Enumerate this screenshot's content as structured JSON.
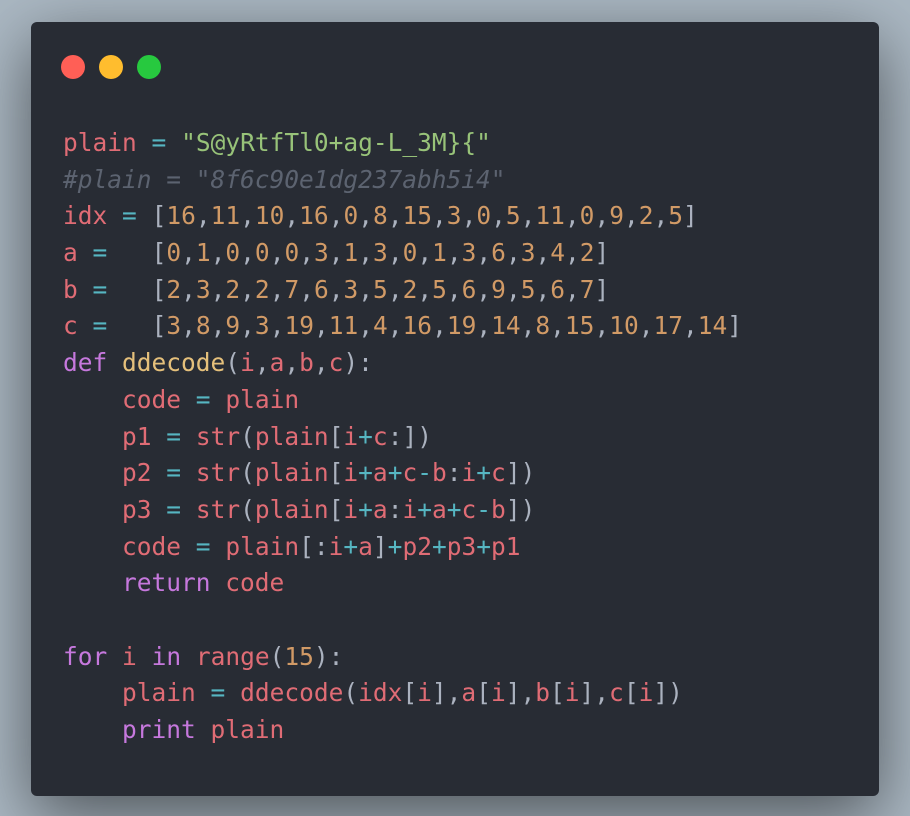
{
  "window": {
    "colors": {
      "background": "#282c34",
      "page": "#abb8c3",
      "red": "#ff5f56",
      "yellow": "#ffbd2e",
      "green": "#27c93f"
    },
    "controls": [
      "close-dot",
      "minimize-dot",
      "maximize-dot"
    ]
  },
  "code_lines": [
    [
      [
        "var",
        "plain"
      ],
      [
        "plain",
        " "
      ],
      [
        "op",
        "="
      ],
      [
        "plain",
        " "
      ],
      [
        "str",
        "\"S@yRtfTl0+ag-L_3M}{\""
      ]
    ],
    [
      [
        "comment",
        "#plain = \"8f6c90e1dg237abh5i4\""
      ]
    ],
    [
      [
        "var",
        "idx"
      ],
      [
        "plain",
        " "
      ],
      [
        "op",
        "="
      ],
      [
        "plain",
        " "
      ],
      [
        "punc",
        "["
      ],
      [
        "num",
        "16"
      ],
      [
        "punc",
        ","
      ],
      [
        "num",
        "11"
      ],
      [
        "punc",
        ","
      ],
      [
        "num",
        "10"
      ],
      [
        "punc",
        ","
      ],
      [
        "num",
        "16"
      ],
      [
        "punc",
        ","
      ],
      [
        "num",
        "0"
      ],
      [
        "punc",
        ","
      ],
      [
        "num",
        "8"
      ],
      [
        "punc",
        ","
      ],
      [
        "num",
        "15"
      ],
      [
        "punc",
        ","
      ],
      [
        "num",
        "3"
      ],
      [
        "punc",
        ","
      ],
      [
        "num",
        "0"
      ],
      [
        "punc",
        ","
      ],
      [
        "num",
        "5"
      ],
      [
        "punc",
        ","
      ],
      [
        "num",
        "11"
      ],
      [
        "punc",
        ","
      ],
      [
        "num",
        "0"
      ],
      [
        "punc",
        ","
      ],
      [
        "num",
        "9"
      ],
      [
        "punc",
        ","
      ],
      [
        "num",
        "2"
      ],
      [
        "punc",
        ","
      ],
      [
        "num",
        "5"
      ],
      [
        "punc",
        "]"
      ]
    ],
    [
      [
        "var",
        "a"
      ],
      [
        "plain",
        " "
      ],
      [
        "op",
        "="
      ],
      [
        "plain",
        "   "
      ],
      [
        "punc",
        "["
      ],
      [
        "num",
        "0"
      ],
      [
        "punc",
        ","
      ],
      [
        "num",
        "1"
      ],
      [
        "punc",
        ","
      ],
      [
        "num",
        "0"
      ],
      [
        "punc",
        ","
      ],
      [
        "num",
        "0"
      ],
      [
        "punc",
        ","
      ],
      [
        "num",
        "0"
      ],
      [
        "punc",
        ","
      ],
      [
        "num",
        "3"
      ],
      [
        "punc",
        ","
      ],
      [
        "num",
        "1"
      ],
      [
        "punc",
        ","
      ],
      [
        "num",
        "3"
      ],
      [
        "punc",
        ","
      ],
      [
        "num",
        "0"
      ],
      [
        "punc",
        ","
      ],
      [
        "num",
        "1"
      ],
      [
        "punc",
        ","
      ],
      [
        "num",
        "3"
      ],
      [
        "punc",
        ","
      ],
      [
        "num",
        "6"
      ],
      [
        "punc",
        ","
      ],
      [
        "num",
        "3"
      ],
      [
        "punc",
        ","
      ],
      [
        "num",
        "4"
      ],
      [
        "punc",
        ","
      ],
      [
        "num",
        "2"
      ],
      [
        "punc",
        "]"
      ]
    ],
    [
      [
        "var",
        "b"
      ],
      [
        "plain",
        " "
      ],
      [
        "op",
        "="
      ],
      [
        "plain",
        "   "
      ],
      [
        "punc",
        "["
      ],
      [
        "num",
        "2"
      ],
      [
        "punc",
        ","
      ],
      [
        "num",
        "3"
      ],
      [
        "punc",
        ","
      ],
      [
        "num",
        "2"
      ],
      [
        "punc",
        ","
      ],
      [
        "num",
        "2"
      ],
      [
        "punc",
        ","
      ],
      [
        "num",
        "7"
      ],
      [
        "punc",
        ","
      ],
      [
        "num",
        "6"
      ],
      [
        "punc",
        ","
      ],
      [
        "num",
        "3"
      ],
      [
        "punc",
        ","
      ],
      [
        "num",
        "5"
      ],
      [
        "punc",
        ","
      ],
      [
        "num",
        "2"
      ],
      [
        "punc",
        ","
      ],
      [
        "num",
        "5"
      ],
      [
        "punc",
        ","
      ],
      [
        "num",
        "6"
      ],
      [
        "punc",
        ","
      ],
      [
        "num",
        "9"
      ],
      [
        "punc",
        ","
      ],
      [
        "num",
        "5"
      ],
      [
        "punc",
        ","
      ],
      [
        "num",
        "6"
      ],
      [
        "punc",
        ","
      ],
      [
        "num",
        "7"
      ],
      [
        "punc",
        "]"
      ]
    ],
    [
      [
        "var",
        "c"
      ],
      [
        "plain",
        " "
      ],
      [
        "op",
        "="
      ],
      [
        "plain",
        "   "
      ],
      [
        "punc",
        "["
      ],
      [
        "num",
        "3"
      ],
      [
        "punc",
        ","
      ],
      [
        "num",
        "8"
      ],
      [
        "punc",
        ","
      ],
      [
        "num",
        "9"
      ],
      [
        "punc",
        ","
      ],
      [
        "num",
        "3"
      ],
      [
        "punc",
        ","
      ],
      [
        "num",
        "19"
      ],
      [
        "punc",
        ","
      ],
      [
        "num",
        "11"
      ],
      [
        "punc",
        ","
      ],
      [
        "num",
        "4"
      ],
      [
        "punc",
        ","
      ],
      [
        "num",
        "16"
      ],
      [
        "punc",
        ","
      ],
      [
        "num",
        "19"
      ],
      [
        "punc",
        ","
      ],
      [
        "num",
        "14"
      ],
      [
        "punc",
        ","
      ],
      [
        "num",
        "8"
      ],
      [
        "punc",
        ","
      ],
      [
        "num",
        "15"
      ],
      [
        "punc",
        ","
      ],
      [
        "num",
        "10"
      ],
      [
        "punc",
        ","
      ],
      [
        "num",
        "17"
      ],
      [
        "punc",
        ","
      ],
      [
        "num",
        "14"
      ],
      [
        "punc",
        "]"
      ]
    ],
    [
      [
        "kw",
        "def"
      ],
      [
        "plain",
        " "
      ],
      [
        "fn",
        "ddecode"
      ],
      [
        "punc",
        "("
      ],
      [
        "var",
        "i"
      ],
      [
        "punc",
        ","
      ],
      [
        "var",
        "a"
      ],
      [
        "punc",
        ","
      ],
      [
        "var",
        "b"
      ],
      [
        "punc",
        ","
      ],
      [
        "var",
        "c"
      ],
      [
        "punc",
        "):"
      ]
    ],
    [
      [
        "plain",
        "    "
      ],
      [
        "var",
        "code"
      ],
      [
        "plain",
        " "
      ],
      [
        "op",
        "="
      ],
      [
        "plain",
        " "
      ],
      [
        "var",
        "plain"
      ]
    ],
    [
      [
        "plain",
        "    "
      ],
      [
        "var",
        "p1"
      ],
      [
        "plain",
        " "
      ],
      [
        "op",
        "="
      ],
      [
        "plain",
        " "
      ],
      [
        "call",
        "str"
      ],
      [
        "punc",
        "("
      ],
      [
        "var",
        "plain"
      ],
      [
        "punc",
        "["
      ],
      [
        "var",
        "i"
      ],
      [
        "op",
        "+"
      ],
      [
        "var",
        "c"
      ],
      [
        "punc",
        ":])"
      ]
    ],
    [
      [
        "plain",
        "    "
      ],
      [
        "var",
        "p2"
      ],
      [
        "plain",
        " "
      ],
      [
        "op",
        "="
      ],
      [
        "plain",
        " "
      ],
      [
        "call",
        "str"
      ],
      [
        "punc",
        "("
      ],
      [
        "var",
        "plain"
      ],
      [
        "punc",
        "["
      ],
      [
        "var",
        "i"
      ],
      [
        "op",
        "+"
      ],
      [
        "var",
        "a"
      ],
      [
        "op",
        "+"
      ],
      [
        "var",
        "c"
      ],
      [
        "op",
        "-"
      ],
      [
        "var",
        "b"
      ],
      [
        "punc",
        ":"
      ],
      [
        "var",
        "i"
      ],
      [
        "op",
        "+"
      ],
      [
        "var",
        "c"
      ],
      [
        "punc",
        "])"
      ]
    ],
    [
      [
        "plain",
        "    "
      ],
      [
        "var",
        "p3"
      ],
      [
        "plain",
        " "
      ],
      [
        "op",
        "="
      ],
      [
        "plain",
        " "
      ],
      [
        "call",
        "str"
      ],
      [
        "punc",
        "("
      ],
      [
        "var",
        "plain"
      ],
      [
        "punc",
        "["
      ],
      [
        "var",
        "i"
      ],
      [
        "op",
        "+"
      ],
      [
        "var",
        "a"
      ],
      [
        "punc",
        ":"
      ],
      [
        "var",
        "i"
      ],
      [
        "op",
        "+"
      ],
      [
        "var",
        "a"
      ],
      [
        "op",
        "+"
      ],
      [
        "var",
        "c"
      ],
      [
        "op",
        "-"
      ],
      [
        "var",
        "b"
      ],
      [
        "punc",
        "])"
      ]
    ],
    [
      [
        "plain",
        "    "
      ],
      [
        "var",
        "code"
      ],
      [
        "plain",
        " "
      ],
      [
        "op",
        "="
      ],
      [
        "plain",
        " "
      ],
      [
        "var",
        "plain"
      ],
      [
        "punc",
        "[:"
      ],
      [
        "var",
        "i"
      ],
      [
        "op",
        "+"
      ],
      [
        "var",
        "a"
      ],
      [
        "punc",
        "]"
      ],
      [
        "op",
        "+"
      ],
      [
        "var",
        "p2"
      ],
      [
        "op",
        "+"
      ],
      [
        "var",
        "p3"
      ],
      [
        "op",
        "+"
      ],
      [
        "var",
        "p1"
      ]
    ],
    [
      [
        "plain",
        "    "
      ],
      [
        "kw",
        "return"
      ],
      [
        "plain",
        " "
      ],
      [
        "var",
        "code"
      ]
    ],
    [],
    [
      [
        "kw",
        "for"
      ],
      [
        "plain",
        " "
      ],
      [
        "var",
        "i"
      ],
      [
        "plain",
        " "
      ],
      [
        "kw",
        "in"
      ],
      [
        "plain",
        " "
      ],
      [
        "call",
        "range"
      ],
      [
        "punc",
        "("
      ],
      [
        "num",
        "15"
      ],
      [
        "punc",
        "):"
      ]
    ],
    [
      [
        "plain",
        "    "
      ],
      [
        "var",
        "plain"
      ],
      [
        "plain",
        " "
      ],
      [
        "op",
        "="
      ],
      [
        "plain",
        " "
      ],
      [
        "call",
        "ddecode"
      ],
      [
        "punc",
        "("
      ],
      [
        "var",
        "idx"
      ],
      [
        "punc",
        "["
      ],
      [
        "var",
        "i"
      ],
      [
        "punc",
        "],"
      ],
      [
        "var",
        "a"
      ],
      [
        "punc",
        "["
      ],
      [
        "var",
        "i"
      ],
      [
        "punc",
        "],"
      ],
      [
        "var",
        "b"
      ],
      [
        "punc",
        "["
      ],
      [
        "var",
        "i"
      ],
      [
        "punc",
        "],"
      ],
      [
        "var",
        "c"
      ],
      [
        "punc",
        "["
      ],
      [
        "var",
        "i"
      ],
      [
        "punc",
        "])"
      ]
    ],
    [
      [
        "plain",
        "    "
      ],
      [
        "kw",
        "print"
      ],
      [
        "plain",
        " "
      ],
      [
        "var",
        "plain"
      ]
    ]
  ]
}
